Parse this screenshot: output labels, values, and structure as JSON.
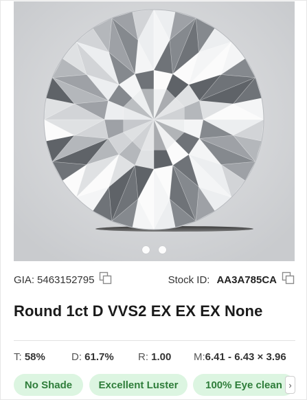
{
  "listing": {
    "gia_label": "GIA:",
    "gia_number": "5463152795",
    "stock_label": "Stock ID:",
    "stock_id": "AA3A785CA",
    "title": "Round 1ct D VVS2 EX EX EX None"
  },
  "carousel": {
    "slides": 2,
    "active_index": 0
  },
  "specs": [
    {
      "label": "T:",
      "value": "58%"
    },
    {
      "label": "D:",
      "value": "61.7%"
    },
    {
      "label": "R:",
      "value": "1.00"
    },
    {
      "label": "M:",
      "value": "6.41 - 6.43 × 3.96"
    }
  ],
  "tags": [
    "No Shade",
    "Excellent Luster",
    "100% Eye clean"
  ],
  "more_icon": "chevron-right-icon",
  "colors": {
    "tag_bg": "#dcf5e1",
    "tag_text": "#2e7d3a",
    "image_bg": "#d4d6d9"
  }
}
